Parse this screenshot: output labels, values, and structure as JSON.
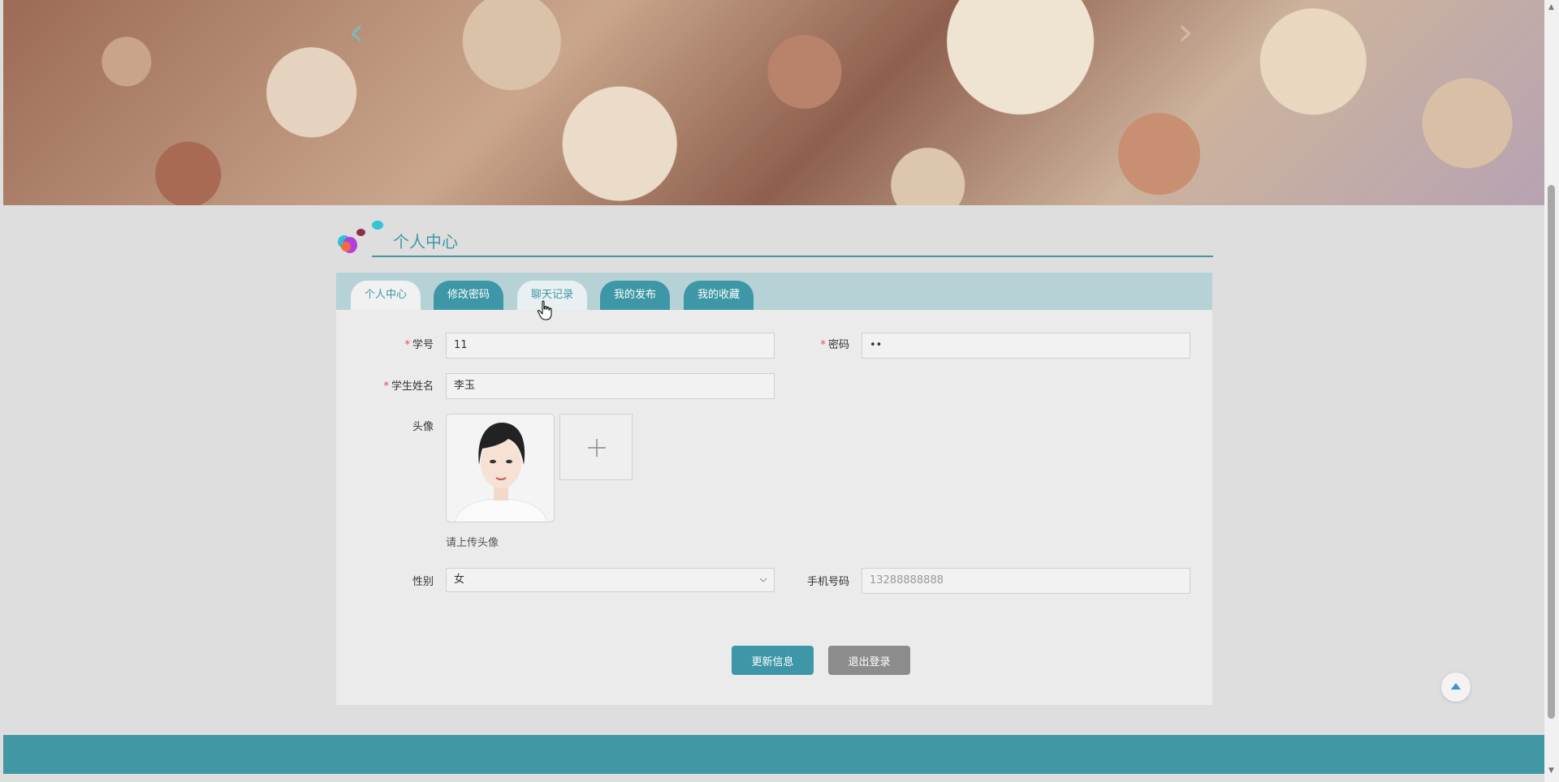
{
  "banner": {
    "prev_icon": "chevron-left-icon",
    "next_icon": "chevron-right-icon"
  },
  "section": {
    "title": "个人中心"
  },
  "tabs": [
    {
      "label": "个人中心",
      "state": "active"
    },
    {
      "label": "修改密码",
      "state": "normal"
    },
    {
      "label": "聊天记录",
      "state": "hover"
    },
    {
      "label": "我的发布",
      "state": "normal"
    },
    {
      "label": "我的收藏",
      "state": "normal"
    }
  ],
  "form": {
    "student_id": {
      "label": "学号",
      "value": "11",
      "required": "*"
    },
    "password": {
      "label": "密码",
      "value": "••",
      "required": "*"
    },
    "student_name": {
      "label": "学生姓名",
      "value": "李玉",
      "required": "*"
    },
    "avatar": {
      "label": "头像",
      "hint": "请上传头像"
    },
    "gender": {
      "label": "性别",
      "value": "女"
    },
    "phone": {
      "label": "手机号码",
      "placeholder": "13288888888"
    }
  },
  "buttons": {
    "update": "更新信息",
    "logout": "退出登录"
  },
  "colors": {
    "accent": "#4197a4",
    "tab_bar": "#b7d2d6",
    "logout_gray": "#8c8c8c",
    "required": "#e84a4a"
  }
}
